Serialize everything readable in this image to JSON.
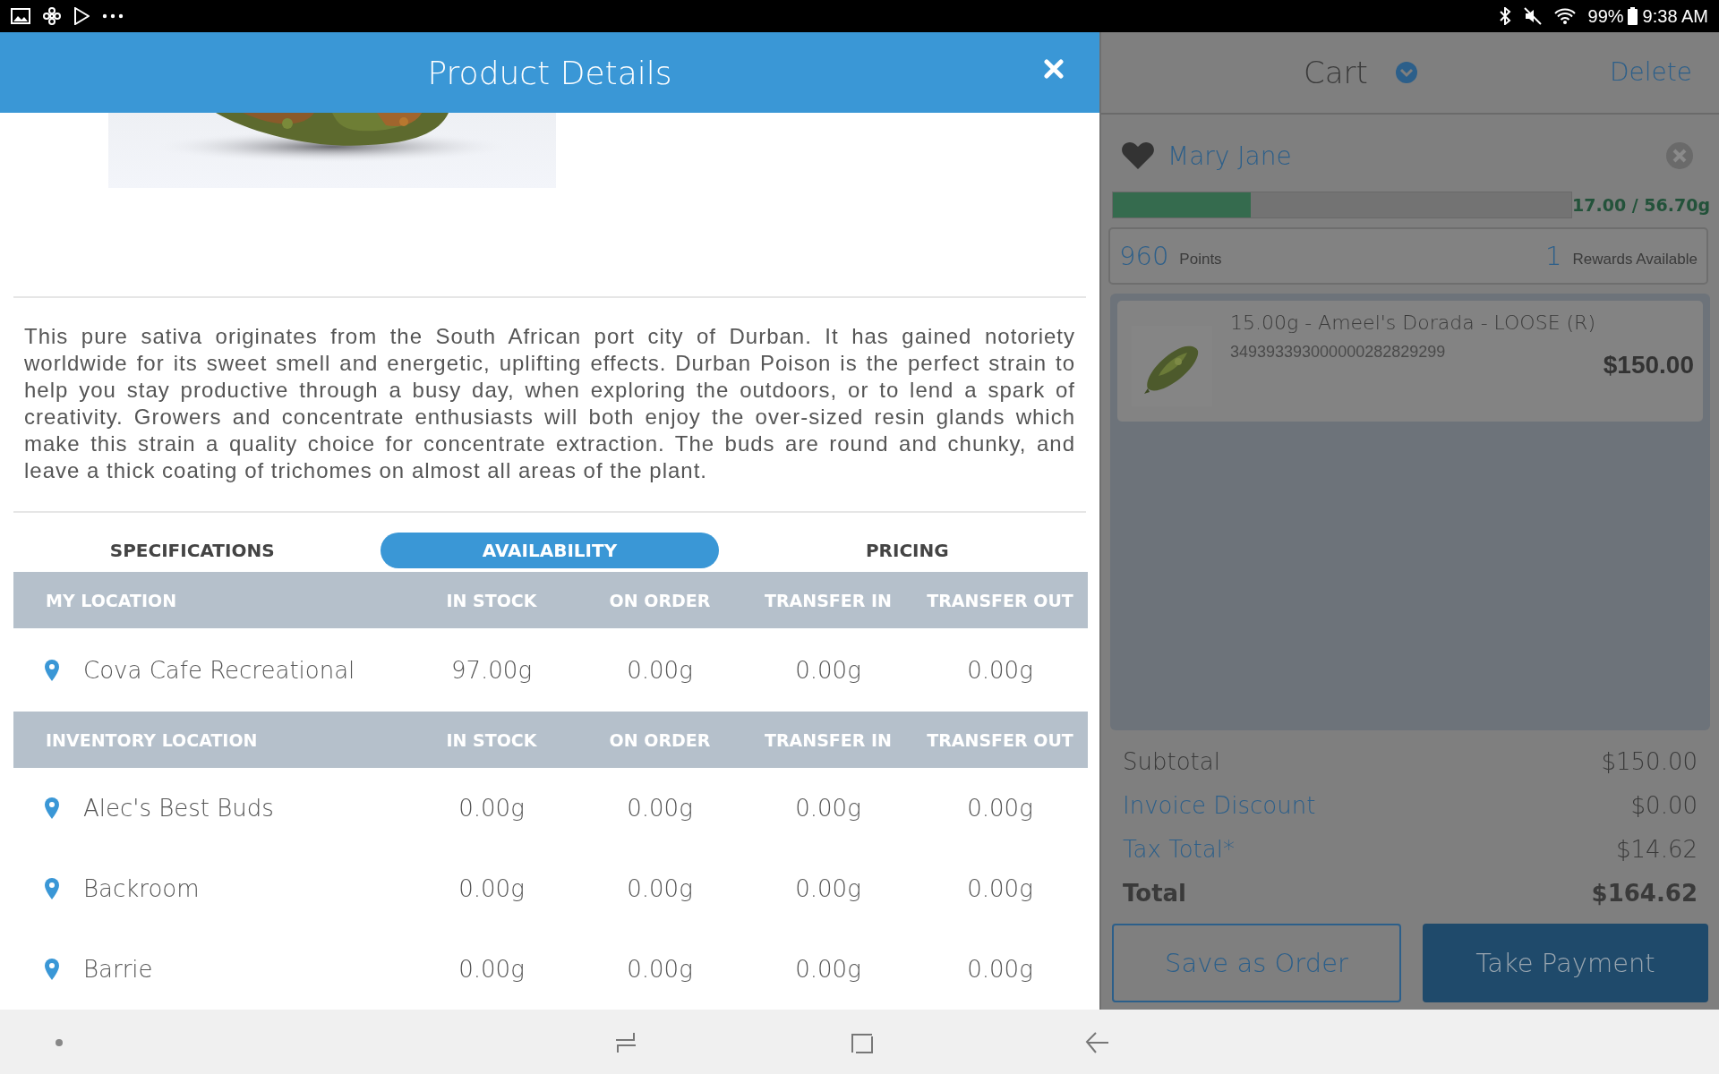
{
  "status_bar": {
    "battery": "99%",
    "time": "9:38 AM"
  },
  "product_details": {
    "title": "Product Details",
    "description": "This pure sativa originates from the South African port city of Durban. It has gained notoriety worldwide for its sweet smell and energetic, uplifting effects. Durban Poison is the perfect strain to help you stay productive through a busy day, when exploring the outdoors, or to lend a spark of creativity. Growers and concentrate enthusiasts will both enjoy the over-sized resin glands which make this strain a quality choice for concentrate extraction. The buds are round and chunky, and leave a thick coating of trichomes on almost all areas of the plant.",
    "tabs": [
      {
        "label": "SPECIFICATIONS",
        "selected": false
      },
      {
        "label": "AVAILABILITY",
        "selected": true
      },
      {
        "label": "PRICING",
        "selected": false
      }
    ],
    "tables": [
      {
        "columns": [
          "MY LOCATION",
          "IN STOCK",
          "ON ORDER",
          "TRANSFER IN",
          "TRANSFER OUT"
        ],
        "rows": [
          {
            "location": "Cova Cafe Recreational",
            "in_stock": "97.00g",
            "on_order": "0.00g",
            "transfer_in": "0.00g",
            "transfer_out": "0.00g"
          }
        ]
      },
      {
        "columns": [
          "INVENTORY LOCATION",
          "IN STOCK",
          "ON ORDER",
          "TRANSFER IN",
          "TRANSFER OUT"
        ],
        "rows": [
          {
            "location": "Alec's Best Buds",
            "in_stock": "0.00g",
            "on_order": "0.00g",
            "transfer_in": "0.00g",
            "transfer_out": "0.00g"
          },
          {
            "location": "Backroom",
            "in_stock": "0.00g",
            "on_order": "0.00g",
            "transfer_in": "0.00g",
            "transfer_out": "0.00g"
          },
          {
            "location": "Barrie",
            "in_stock": "0.00g",
            "on_order": "0.00g",
            "transfer_in": "0.00g",
            "transfer_out": "0.00g"
          }
        ]
      }
    ]
  },
  "cart": {
    "title": "Cart",
    "delete": "Delete",
    "customer": {
      "name": "Mary Jane"
    },
    "limit": {
      "level": 0.3,
      "reading": "17.00 / 56.70g"
    },
    "points": {
      "value": "960",
      "label": "Points"
    },
    "rewards": {
      "value": "1",
      "label": "Rewards Available"
    },
    "items": [
      {
        "title": "15.00g - Ameel's Dorada - LOOSE (R)",
        "sku": "349393393000000282829299",
        "price": "$150.00"
      }
    ],
    "totals": [
      {
        "label": "Subtotal",
        "value": "$150.00",
        "kind": "plain"
      },
      {
        "label": "Invoice Discount",
        "value": "$0.00",
        "kind": "link"
      },
      {
        "label": "Tax Total*",
        "value": "$14.62",
        "kind": "link"
      },
      {
        "label": "Total",
        "value": "$164.62",
        "kind": "bold"
      }
    ],
    "buttons": [
      {
        "label": "Save as Order",
        "kind": "outline"
      },
      {
        "label": "Take Payment",
        "kind": "primary"
      }
    ]
  }
}
